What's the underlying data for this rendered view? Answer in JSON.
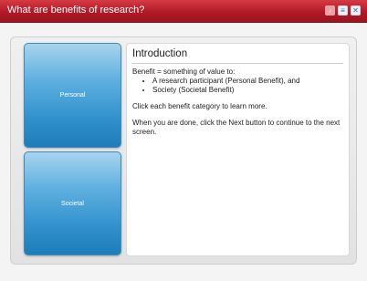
{
  "window": {
    "title": "What are benefits of research?",
    "controls": [
      {
        "name": "audio-icon",
        "glyph": "♪"
      },
      {
        "name": "menu-icon",
        "glyph": "≡"
      },
      {
        "name": "close-icon",
        "glyph": "✕"
      }
    ]
  },
  "categories": [
    {
      "label": "Personal"
    },
    {
      "label": "Societal"
    }
  ],
  "content": {
    "heading": "Introduction",
    "lead": "Benefit = something of value to:",
    "bullets": [
      "A research participant (Personal Benefit), and",
      "Society (Societal Benefit)"
    ],
    "instruction": "Click each benefit category to learn more.",
    "next_text": "When you are done, click the Next button to continue to the next screen."
  },
  "colors": {
    "titlebar": "#b01a27",
    "category_button": "#2e8fcb",
    "content_background": "#ffffff"
  }
}
